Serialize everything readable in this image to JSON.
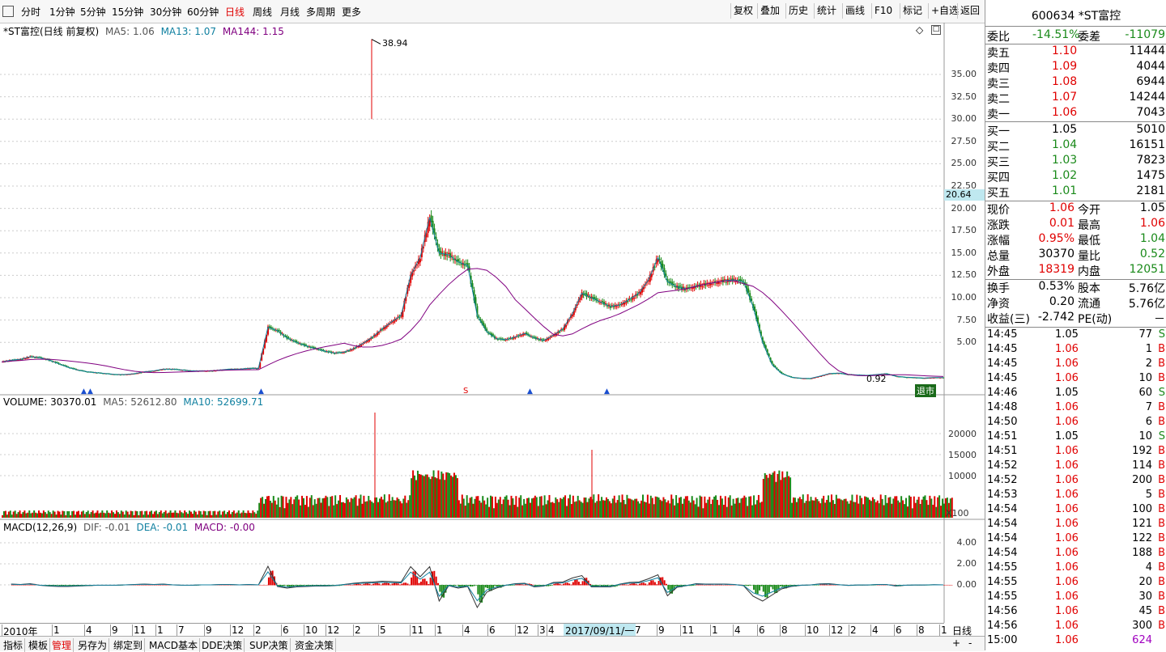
{
  "toolbar": {
    "tabs": [
      "分时",
      "1分钟",
      "5分钟",
      "15分钟",
      "30分钟",
      "60分钟",
      "日线",
      "周线",
      "月线",
      "多周期",
      "更多"
    ],
    "active_tab": "日线",
    "right_buttons": [
      "复权",
      "叠加",
      "历史",
      "统计",
      "画线",
      "F10",
      "标记",
      "+自选",
      "返回"
    ]
  },
  "chart_header": {
    "title": "*ST富控(日线 前复权)",
    "ma5": "MA5: 1.06",
    "ma13": "MA13: 1.07",
    "ma144": "MA144: 1.15"
  },
  "price_axis": [
    "35.00",
    "32.50",
    "30.00",
    "27.50",
    "25.00",
    "22.50",
    "20.00",
    "17.50",
    "15.00",
    "12.50",
    "10.00",
    "7.50",
    "5.00"
  ],
  "price_marker": "20.64",
  "annotations": {
    "high": "38.94",
    "low": "0.92"
  },
  "volume_header": {
    "label": "VOLUME: 30370.01",
    "ma5": "MA5: 52612.80",
    "ma10": "MA10: 52699.71"
  },
  "volume_axis": [
    "20000",
    "15000",
    "10000"
  ],
  "volume_unit": "X100",
  "macd_header": {
    "label": "MACD(12,26,9)",
    "dif": "DIF: -0.01",
    "dea": "DEA: -0.01",
    "macd": "MACD: -0.00"
  },
  "macd_axis": [
    "4.00",
    "2.00",
    "0.00"
  ],
  "date_axis": [
    "2010年",
    "1",
    "4",
    "9",
    "11",
    "1",
    "7",
    "9",
    "12",
    "2",
    "6",
    "10",
    "12",
    "2",
    "5",
    "11",
    "1",
    "4",
    "6",
    "12",
    "3",
    "4",
    "7",
    "9",
    "11",
    "1",
    "4",
    "6",
    "8",
    "10",
    "12",
    "2",
    "4",
    "6",
    "8",
    "1"
  ],
  "date_cursor": "2017/09/11/一",
  "period_label": "日线",
  "badge": "退市",
  "bottom_tabs": [
    "指标",
    "模板",
    "管理",
    "另存为",
    "绑定到",
    "MACD基本",
    "DDE决策",
    "SUP决策",
    "资金决策"
  ],
  "active_bottom_tab": "管理",
  "quote": {
    "stock_title": "600634 *ST富控",
    "weibi_label": "委比",
    "weibi": "-14.51%",
    "weicha_label": "委差",
    "weicha": "-11079",
    "asks": [
      {
        "label": "卖五",
        "price": "1.10",
        "vol": "11444"
      },
      {
        "label": "卖四",
        "price": "1.09",
        "vol": "4044"
      },
      {
        "label": "卖三",
        "price": "1.08",
        "vol": "6944"
      },
      {
        "label": "卖二",
        "price": "1.07",
        "vol": "14244"
      },
      {
        "label": "卖一",
        "price": "1.06",
        "vol": "7043"
      }
    ],
    "bids": [
      {
        "label": "买一",
        "price": "1.05",
        "vol": "5010",
        "color": "black"
      },
      {
        "label": "买二",
        "price": "1.04",
        "vol": "16151",
        "color": "green"
      },
      {
        "label": "买三",
        "price": "1.03",
        "vol": "7823",
        "color": "green"
      },
      {
        "label": "买四",
        "price": "1.02",
        "vol": "1475",
        "color": "green"
      },
      {
        "label": "买五",
        "price": "1.01",
        "vol": "2181",
        "color": "green"
      }
    ],
    "stats": [
      {
        "l1": "现价",
        "v1": "1.06",
        "c1": "red",
        "l2": "今开",
        "v2": "1.05",
        "c2": "black"
      },
      {
        "l1": "涨跌",
        "v1": "0.01",
        "c1": "red",
        "l2": "最高",
        "v2": "1.06",
        "c2": "red"
      },
      {
        "l1": "涨幅",
        "v1": "0.95%",
        "c1": "red",
        "l2": "最低",
        "v2": "1.04",
        "c2": "green"
      },
      {
        "l1": "总量",
        "v1": "30370",
        "c1": "black",
        "l2": "量比",
        "v2": "0.52",
        "c2": "green"
      },
      {
        "l1": "外盘",
        "v1": "18319",
        "c1": "red",
        "l2": "内盘",
        "v2": "12051",
        "c2": "green"
      }
    ],
    "stats2": [
      {
        "l1": "换手",
        "v1": "0.53%",
        "l2": "股本",
        "v2": "5.76亿"
      },
      {
        "l1": "净资",
        "v1": "0.20",
        "l2": "流通",
        "v2": "5.76亿"
      },
      {
        "l1": "收益(三)",
        "v1": "-2.742",
        "l2": "PE(动)",
        "v2": "－"
      }
    ],
    "ticks": [
      {
        "t": "14:45",
        "p": "1.05",
        "v": "77",
        "d": "S"
      },
      {
        "t": "14:45",
        "p": "1.06",
        "v": "1",
        "d": "B"
      },
      {
        "t": "14:45",
        "p": "1.06",
        "v": "2",
        "d": "B"
      },
      {
        "t": "14:45",
        "p": "1.06",
        "v": "10",
        "d": "B"
      },
      {
        "t": "14:46",
        "p": "1.05",
        "v": "60",
        "d": "S"
      },
      {
        "t": "14:48",
        "p": "1.06",
        "v": "7",
        "d": "B"
      },
      {
        "t": "14:50",
        "p": "1.06",
        "v": "6",
        "d": "B"
      },
      {
        "t": "14:51",
        "p": "1.05",
        "v": "10",
        "d": "S"
      },
      {
        "t": "14:51",
        "p": "1.06",
        "v": "192",
        "d": "B"
      },
      {
        "t": "14:52",
        "p": "1.06",
        "v": "114",
        "d": "B"
      },
      {
        "t": "14:52",
        "p": "1.06",
        "v": "200",
        "d": "B"
      },
      {
        "t": "14:53",
        "p": "1.06",
        "v": "5",
        "d": "B"
      },
      {
        "t": "14:54",
        "p": "1.06",
        "v": "100",
        "d": "B"
      },
      {
        "t": "14:54",
        "p": "1.06",
        "v": "121",
        "d": "B"
      },
      {
        "t": "14:54",
        "p": "1.06",
        "v": "122",
        "d": "B"
      },
      {
        "t": "14:54",
        "p": "1.06",
        "v": "188",
        "d": "B"
      },
      {
        "t": "14:55",
        "p": "1.06",
        "v": "4",
        "d": "B"
      },
      {
        "t": "14:55",
        "p": "1.06",
        "v": "20",
        "d": "B"
      },
      {
        "t": "14:55",
        "p": "1.06",
        "v": "30",
        "d": "B"
      },
      {
        "t": "14:56",
        "p": "1.06",
        "v": "45",
        "d": "B"
      },
      {
        "t": "14:56",
        "p": "1.06",
        "v": "300",
        "d": "B"
      },
      {
        "t": "15:00",
        "p": "1.06",
        "v": "624",
        "d": ""
      }
    ]
  },
  "colors": {
    "up": "#e00000",
    "down": "#1a8a1a",
    "ma5": "#555555",
    "ma13": "#1080a0",
    "ma144": "#800080",
    "axis_marker": "#bfe8f0"
  },
  "price_path": [
    2.8,
    3.0,
    3.1,
    3.4,
    3.3,
    3.0,
    2.6,
    2.2,
    1.9,
    1.7,
    1.6,
    1.5,
    1.4,
    1.4,
    1.5,
    1.7,
    1.8,
    2.0,
    2.0,
    1.9,
    1.8,
    1.8,
    1.8,
    1.9,
    2.0,
    2.0,
    2.1,
    2.1,
    6.7,
    6.3,
    5.5,
    5.0,
    4.6,
    4.3,
    4.0,
    3.8,
    3.9,
    4.3,
    4.9,
    5.6,
    6.5,
    7.3,
    8.0,
    12.5,
    14.5,
    19.0,
    15.0,
    14.8,
    14.0,
    13.6,
    8.0,
    6.2,
    5.4,
    5.3,
    5.6,
    6.0,
    5.5,
    5.2,
    5.8,
    6.5,
    8.2,
    10.5,
    10.0,
    9.5,
    9.0,
    9.2,
    9.8,
    10.5,
    12.0,
    14.5,
    11.8,
    11.2,
    11.0,
    11.3,
    11.5,
    11.7,
    11.9,
    12.0,
    11.8,
    9.0,
    5.0,
    2.5,
    1.5,
    1.1,
    0.98,
    0.95,
    1.2,
    1.5,
    1.55,
    1.4,
    1.35,
    1.3,
    1.4,
    1.5,
    1.2,
    1.1,
    1.05,
    1.0,
    1.05,
    1.06
  ]
}
